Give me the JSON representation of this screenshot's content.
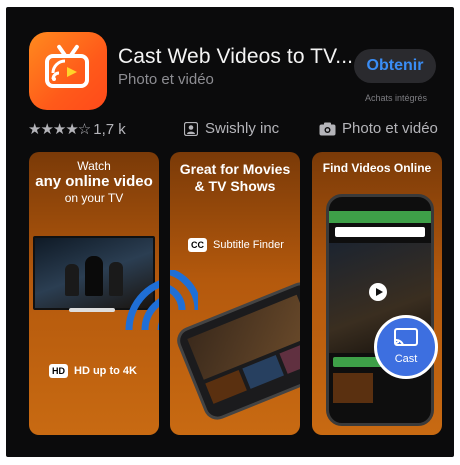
{
  "app": {
    "title": "Cast Web Videos to TV...",
    "category": "Photo et vidéo",
    "get_label": "Obtenir",
    "iap_label": "Achats intégrés"
  },
  "meta": {
    "rating_stars": "★★★★☆",
    "rating_count": "1,7 k",
    "developer_icon": "person-icon",
    "developer": "Swishly inc",
    "category_icon": "camera-icon",
    "category": "Photo et vidéo"
  },
  "screenshots": [
    {
      "line1": "Watch",
      "line2": "any online video",
      "line3": "on your TV",
      "badge": "HD",
      "feature": "HD up to 4K"
    },
    {
      "line1": "Great for Movies",
      "line2": "& TV Shows",
      "badge": "CC",
      "feature": "Subtitle Finder"
    },
    {
      "line1": "Find Videos Online",
      "cast_label": "Cast"
    }
  ],
  "colors": {
    "accent": "#3a8df5",
    "brand": "#ff6a1a",
    "background": "#0b0b0c"
  }
}
